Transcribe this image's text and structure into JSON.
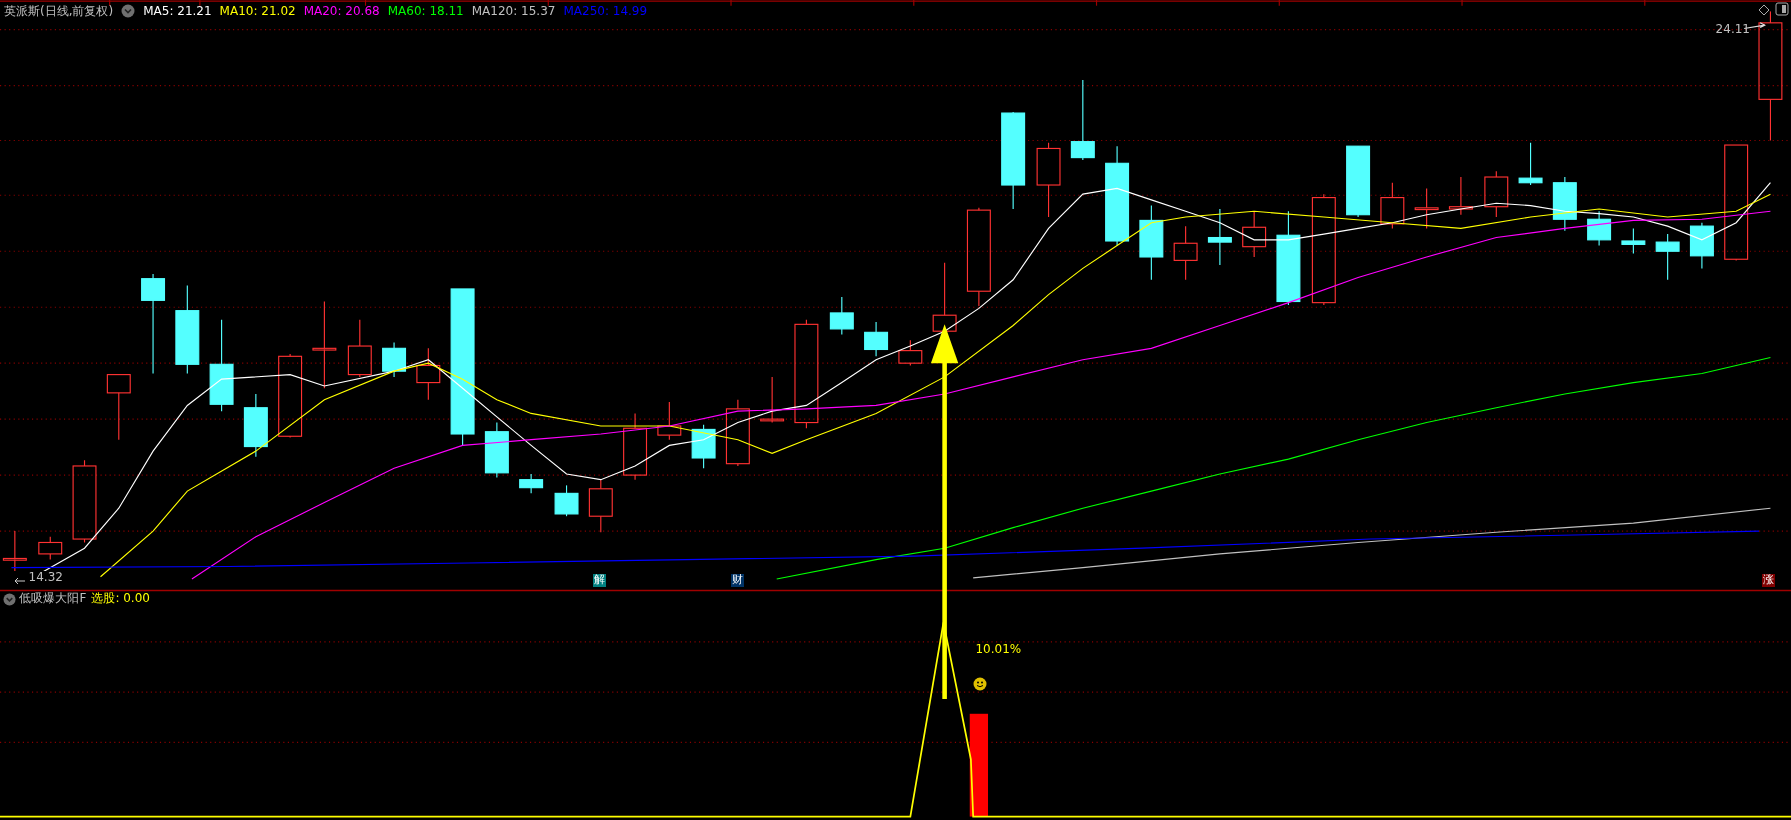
{
  "main_panel": {
    "title": "英派斯(日线,前复权)",
    "moving_averages": [
      {
        "label": "MA5: 21.21",
        "color": "#ffffff"
      },
      {
        "label": "MA10: 21.02",
        "color": "#ffff00"
      },
      {
        "label": "MA20: 20.68",
        "color": "#ff00ff"
      },
      {
        "label": "MA60: 18.11",
        "color": "#00ff00"
      },
      {
        "label": "MA120: 15.37",
        "color": "#c0c0c0"
      },
      {
        "label": "MA250: 14.99",
        "color": "#0000ff"
      }
    ],
    "high_label": "24.11",
    "low_label": "14.32",
    "markers": [
      {
        "text": "解",
        "color": "#008080"
      },
      {
        "text": "财",
        "color": "#003366"
      },
      {
        "text": "涨",
        "color": "#800000"
      }
    ]
  },
  "indicator_panel": {
    "title": "低吸爆大阳F",
    "output_label": "选股: 0.00",
    "signal_label": "10.01%"
  }
}
